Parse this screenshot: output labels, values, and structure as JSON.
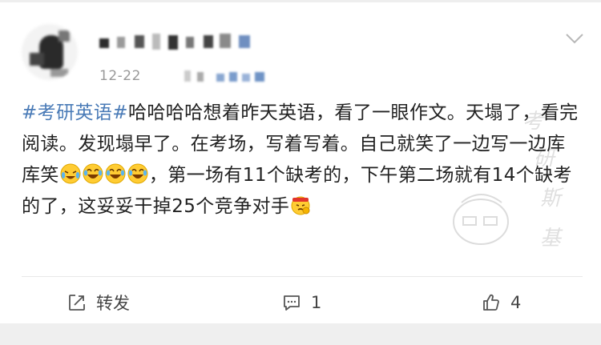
{
  "post": {
    "timestamp": "12-22",
    "hashtag": "#考研英语#",
    "body": "哈哈哈哈想着昨天英语，看了一眼作文。天塌了，看完阅读。发现塌早了。在考场，写着写着。自己就笑了一边写一边库库笑",
    "body_after_emojis": "，第一场有11个缺考的，下午第二场就有14个缺考的了，这妥妥干掉25个竞争对手",
    "emojis_inline": [
      "crying-laughing-emoji",
      "laughing-tears-emoji",
      "laughing-tears-emoji",
      "laughing-tears-emoji"
    ],
    "emoji_end": "fighting-emoji"
  },
  "watermark": {
    "chars": [
      "考",
      "研",
      "斯",
      "基"
    ]
  },
  "actions": {
    "repost_label": "转发",
    "comment_count": "1",
    "like_count": "4"
  },
  "colors": {
    "hashtag": "#4a7bb7",
    "text": "#222222",
    "meta": "#999999",
    "background": "#f2f2f2"
  }
}
